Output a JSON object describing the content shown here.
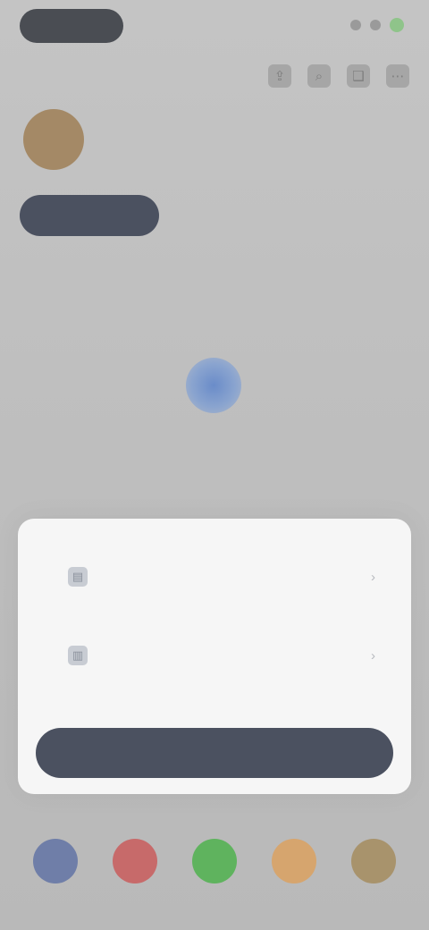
{
  "status_bar": {
    "time": "",
    "dots": [
      "signal",
      "wifi",
      "battery"
    ],
    "battery_color": "#8fc48a"
  },
  "toolbar": {
    "icons": [
      "share-icon",
      "search-icon",
      "bookmark-icon",
      "more-icon"
    ]
  },
  "profile": {
    "name": "",
    "subtitle": "",
    "avatar_color": "#a48966"
  },
  "actions": {
    "primary_label": "",
    "chip_one": "",
    "chip_two": ""
  },
  "meta": {
    "left": "",
    "right": ""
  },
  "empty_state": {
    "title": "",
    "icon_color": "#6a8cc9"
  },
  "sheet": {
    "rows": [
      {
        "title": "",
        "subtitle": "",
        "icon": "document-icon"
      },
      {
        "title": "",
        "subtitle": "",
        "icon": "folder-icon"
      }
    ],
    "button_label": ""
  },
  "dock": {
    "apps": [
      {
        "name": "app-one",
        "color": "#6f7ea8"
      },
      {
        "name": "app-two",
        "color": "#c76a6a"
      },
      {
        "name": "app-three",
        "color": "#5fb35e"
      },
      {
        "name": "app-four",
        "color": "#d6a56e"
      },
      {
        "name": "app-five",
        "color": "#a8936c"
      }
    ]
  },
  "colors": {
    "dark_accent": "#4b5160",
    "sheet_bg": "#f6f6f6",
    "backdrop": "#bdbdbd"
  }
}
